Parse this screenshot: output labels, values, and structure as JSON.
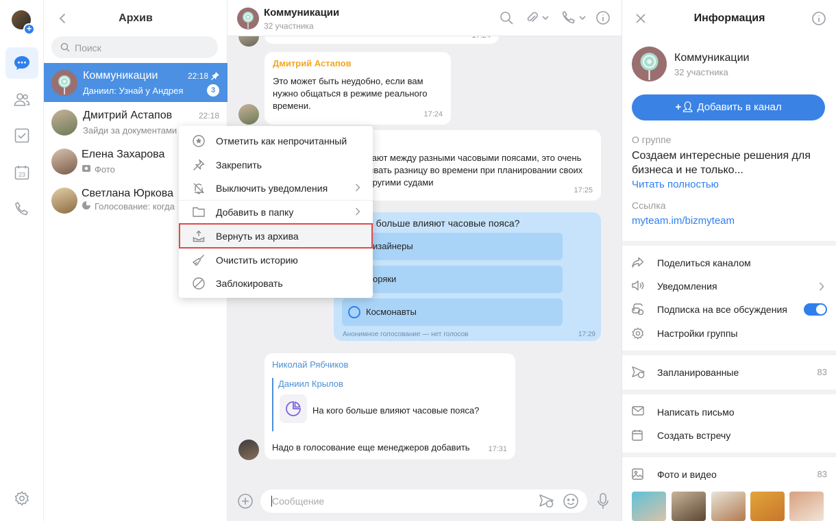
{
  "rail": {
    "items": [
      "chats-icon",
      "contacts-icon",
      "tasks-icon",
      "calendar-icon",
      "calls-icon"
    ],
    "calendar_day": "23",
    "settings": "settings-icon"
  },
  "list": {
    "title": "Архив",
    "search_placeholder": "Поиск",
    "chats": [
      {
        "name": "Коммуникации",
        "time": "22:18",
        "preview": "Даниил: Узнай у Андрея о...",
        "unread": "3"
      },
      {
        "name": "Дмитрий Астапов",
        "time": "22:18",
        "preview": "Зайди за документами"
      },
      {
        "name": "Елена Захарова",
        "preview": "Фото"
      },
      {
        "name": "Светлана Юркова",
        "preview": "Голосование: когда"
      }
    ]
  },
  "chat": {
    "title": "Коммуникации",
    "subtitle": "32 участника",
    "messages": [
      {
        "time": "17:24"
      },
      {
        "author": "Дмитрий Астапов",
        "text": "Это может быть неудобно, если вам нужно общаться в режиме реального времени.",
        "time": "17:24"
      },
      {
        "text_lines": [
          "вают между разными часовыми поясами, это очень",
          "ывать разницу во времени при планировании своих",
          "другими судами"
        ],
        "time": "17:25"
      },
      {
        "author": "Николай Рябчиков",
        "quote_author": "Даниил Крылов",
        "quote_text": "На кого больше влияют часовые пояса?",
        "text": "Надо в голосование еще менеджеров добавить",
        "time": "17:31"
      }
    ],
    "poll": {
      "question": "о больше влияют часовые пояса?",
      "options": [
        "изайнеры",
        "оряки",
        "Космонавты"
      ],
      "footer": "Анонимное голосование — нет голосов",
      "time": "17:29"
    },
    "composer_placeholder": "Сообщение"
  },
  "menu": {
    "items": [
      {
        "label": "Отметить как непрочитанный",
        "icon": "star-icon"
      },
      {
        "label": "Закрепить",
        "icon": "pin-icon"
      },
      {
        "label": "Выключить уведомления",
        "icon": "mute-icon",
        "submenu": true
      },
      {
        "label": "Добавить в папку",
        "icon": "folder-icon",
        "submenu": true
      },
      {
        "label": "Вернуть из архива",
        "icon": "unarchive-icon",
        "highlighted": true
      },
      {
        "label": "Очистить историю",
        "icon": "broom-icon"
      },
      {
        "label": "Заблокировать",
        "icon": "block-icon"
      }
    ]
  },
  "info": {
    "title": "Информация",
    "group_name": "Коммуникации",
    "group_sub": "32 участника",
    "add_button": "Добавить в канал",
    "about_label": "О группе",
    "about_lines": [
      "Создаем интересные решения для",
      "бизнеса и не только..."
    ],
    "read_more": "Читать полностью",
    "link_label": "Ссылка",
    "link": "myteam.im/bizmyteam",
    "actions": [
      {
        "label": "Поделиться каналом"
      },
      {
        "label": "Уведомления"
      },
      {
        "label": "Подписка на все обсуждения",
        "toggle": true
      },
      {
        "label": "Настройки группы"
      }
    ],
    "scheduled": {
      "label": "Запланированные",
      "count": "83"
    },
    "write_letter": "Написать письмо",
    "create_meeting": "Создать встречу",
    "media": {
      "label": "Фото и видео",
      "count": "83"
    }
  },
  "colors": {
    "accent": "#2f80ed",
    "selected_row": "#4b90e2",
    "author_orange": "#f5a623",
    "poll_bg": "#c6e3fb",
    "highlight_border": "#e24848"
  }
}
